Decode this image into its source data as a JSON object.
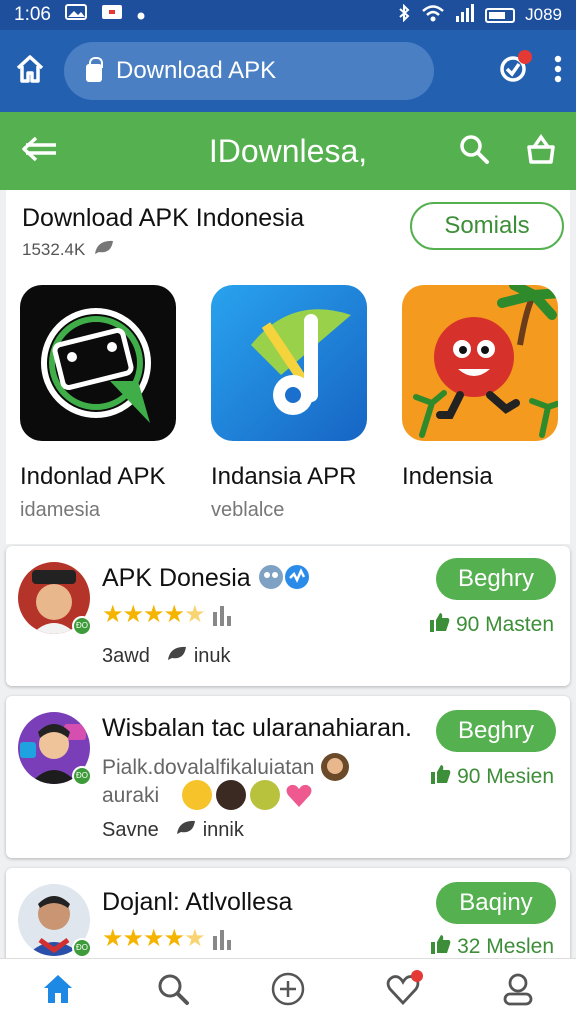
{
  "status_bar": {
    "time": "1:06",
    "right_text": "J089"
  },
  "browser": {
    "url_text": "Download APK"
  },
  "app_bar": {
    "title": "IDownlesa,"
  },
  "featured": {
    "title": "Download APK Indonesia",
    "count": "1532.4K",
    "socials_label": "Somials",
    "apps": [
      {
        "name": "Indonlad APK",
        "sub": "idamesia"
      },
      {
        "name": "Indansia APR",
        "sub": "veblalce"
      },
      {
        "name": "Indensia",
        "sub": ""
      }
    ]
  },
  "list": [
    {
      "title": "APK Donesia",
      "rating": 4.5,
      "footer_left": "3awd",
      "footer_right": "inuk",
      "button": "Beghry",
      "meta": "90 Masten"
    },
    {
      "title": "Wisbalan tac ularanahiaran.",
      "desc1": "Pialk.dovalalfikaluiatan",
      "desc2": "auraki",
      "footer_left": "Savne",
      "footer_right": "innik",
      "button": "Beghry",
      "meta": "90 Mesien"
    },
    {
      "title": "Dojanl: Atlvollesa",
      "rating": 4.5,
      "button": "Baqiny",
      "meta": "32 Meslen"
    }
  ],
  "nav": {
    "items": [
      "home-icon",
      "search-icon",
      "add-icon",
      "favorites-icon",
      "profile-icon"
    ]
  },
  "colors": {
    "primary_blue": "#2460b0",
    "green": "#55b04f",
    "star": "#f4b400"
  }
}
